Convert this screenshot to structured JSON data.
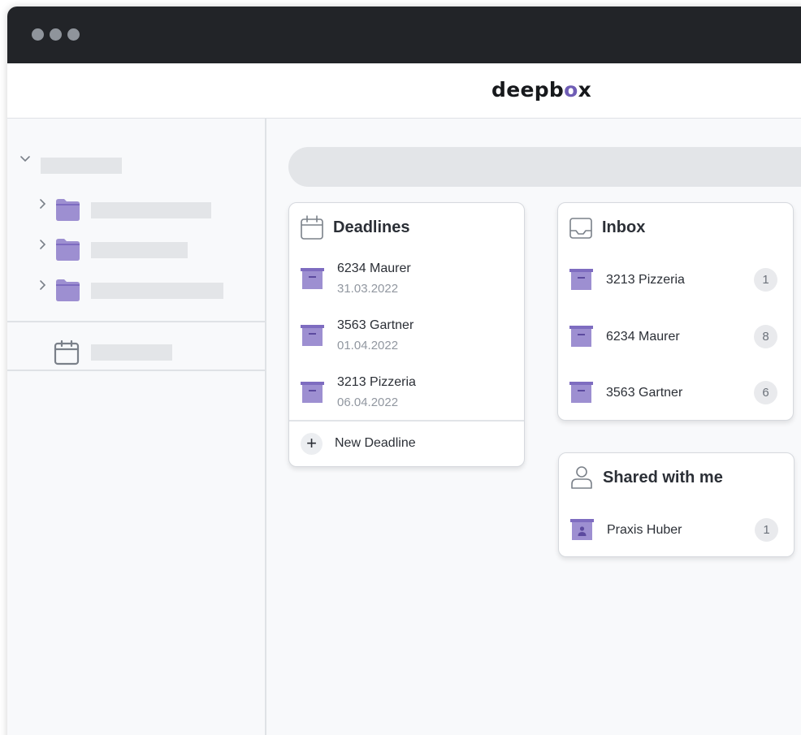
{
  "app": {
    "logo_prefix": "deepb",
    "logo_o": "o",
    "logo_suffix": "x"
  },
  "sidebar": {
    "icons": [
      "chevron-down-icon",
      "chevron-right-icon",
      "folder-icon",
      "calendar-icon"
    ]
  },
  "colors": {
    "accent": "#8f7dc7",
    "accent_dark": "#6f5db5",
    "titlebar": "#222428",
    "placeholder": "#e3e5e8"
  },
  "deadlines": {
    "title": "Deadlines",
    "items": [
      {
        "name": "6234 Maurer",
        "date": "31.03.2022"
      },
      {
        "name": "3563 Gartner",
        "date": "01.04.2022"
      },
      {
        "name": "3213 Pizzeria",
        "date": "06.04.2022"
      }
    ],
    "footer_label": "New Deadline",
    "footer_icon": "+"
  },
  "inbox": {
    "title": "Inbox",
    "items": [
      {
        "name": "3213 Pizzeria",
        "count": "1"
      },
      {
        "name": "6234 Maurer",
        "count": "8"
      },
      {
        "name": "3563 Gartner",
        "count": "6"
      }
    ]
  },
  "shared": {
    "title": "Shared with me",
    "items": [
      {
        "name": "Praxis Huber",
        "count": "1"
      }
    ]
  }
}
